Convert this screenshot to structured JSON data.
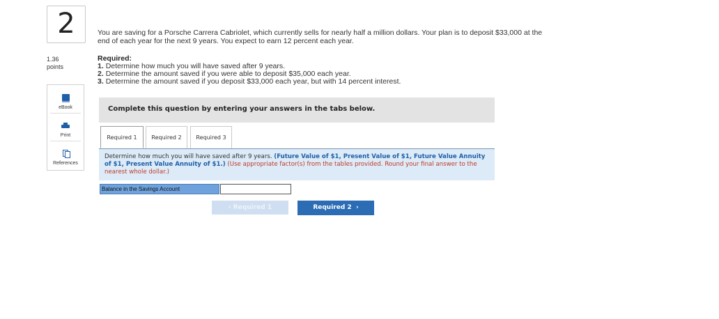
{
  "question": {
    "number": "2",
    "points_value": "1.36",
    "points_label": "points"
  },
  "sidebar": {
    "items": [
      {
        "label": "eBook",
        "icon": "ebook-icon"
      },
      {
        "label": "Print",
        "icon": "print-icon"
      },
      {
        "label": "References",
        "icon": "references-icon"
      }
    ]
  },
  "problem": {
    "text": "You are saving for a Porsche Carrera Cabriolet, which currently sells for nearly half a million dollars. Your plan is to deposit $33,000 at the end of each year for the next 9 years. You expect to earn 12 percent each year.",
    "required_heading": "Required:",
    "requirements": [
      {
        "n": "1.",
        "text": "Determine how much you will have saved after 9 years."
      },
      {
        "n": "2.",
        "text": "Determine the amount saved if you were able to deposit $35,000 each year."
      },
      {
        "n": "3.",
        "text": "Determine the amount saved if you deposit $33,000 each year, but with 14 percent interest."
      }
    ]
  },
  "banner": {
    "text": "Complete this question by entering your answers in the tabs below."
  },
  "tabs": [
    {
      "label": "Required 1",
      "active": true
    },
    {
      "label": "Required 2",
      "active": false
    },
    {
      "label": "Required 3",
      "active": false
    }
  ],
  "instructions": {
    "main": "Determine how much you will have saved after 9 years.",
    "tables": "(Future Value of $1, Present Value of $1, Future Value Annuity of $1, Present Value Annuity of $1.)",
    "note": "(Use appropriate factor(s) from the tables provided. Round your final answer to the nearest whole dollar.)"
  },
  "answer": {
    "label": "Balance in the Savings Account",
    "value": ""
  },
  "nav": {
    "prev_label": "Required 1",
    "next_label": "Required 2",
    "prev_icon": "chevron-left-icon",
    "next_icon": "chevron-right-icon"
  },
  "colors": {
    "accent": "#2b6cb5",
    "banner_bg": "#e3e3e3",
    "instruction_bg": "#dcebf7",
    "answer_label_bg": "#6fa2dc",
    "note_red": "#c0392b"
  }
}
